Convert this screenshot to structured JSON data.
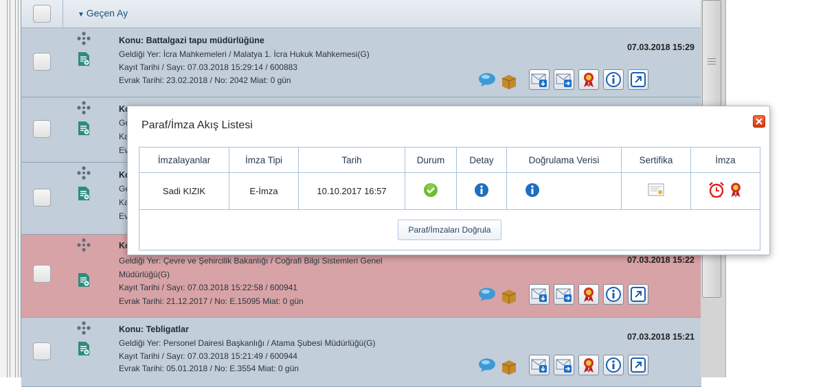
{
  "group": {
    "label": "Geçen Ay"
  },
  "rows": [
    {
      "subject": "Konu: Battalgazi tapu müdürlüğüne",
      "from": "Geldiği Yer: İcra Mahkemeleri / Malatya 1. İcra Hukuk Mahkemesi(G)",
      "record": "Kayıt Tarihi / Sayı: 07.03.2018 15:29:14 / 600883",
      "doc": "Evrak Tarihi: 23.02.2018 / No: 2042 Miat: 0 gün",
      "date": "07.03.2018 15:29",
      "highlight": false
    },
    {
      "subject": "Ko",
      "from": "Ge",
      "record": "Ka",
      "doc": "Ev",
      "date": "",
      "highlight": false
    },
    {
      "subject": "Ko",
      "from": "Ge",
      "record": "Ka",
      "doc": "Ev",
      "date": "",
      "highlight": false
    },
    {
      "subject": "Ko",
      "from": "Geldiği Yer: Çevre ve Şehircilik Bakanlığı / Coğrafi Bilgi Sistemleri Genel",
      "from2": "Müdürlüğü(G)",
      "record": "Kayıt Tarihi / Sayı: 07.03.2018 15:22:58 / 600941",
      "doc": "Evrak Tarihi: 21.12.2017 / No: E.15095 Miat: 0 gün",
      "date": "07.03.2018 15:22",
      "highlight": true
    },
    {
      "subject": "Konu: Tebligatlar",
      "from": "Geldiği Yer: Personel Dairesi Başkanlığı / Atama Şubesi Müdürlüğü(G)",
      "record": "Kayıt Tarihi / Sayı: 07.03.2018 15:21:49 / 600944",
      "doc": "Evrak Tarihi: 05.01.2018 / No: E.3554 Miat: 0 gün",
      "date": "07.03.2018 15:21",
      "highlight": false
    }
  ],
  "dialog": {
    "title": "Paraf/İmza Akış Listesi",
    "columns": [
      "İmzalayanlar",
      "İmza Tipi",
      "Tarih",
      "Durum",
      "Detay",
      "Doğrulama Verisi",
      "Sertifika",
      "İmza"
    ],
    "row": {
      "signer": "Sadi KIZIK",
      "type": "E-İmza",
      "date": "10.10.2017 16:57"
    },
    "verify_button": "Paraf/İmzaları Doğrula"
  },
  "icons": {
    "row": [
      "move-icon",
      "document-add-icon",
      "comment-bubble-icon",
      "package-icon",
      "download-mail-icon",
      "forward-mail-icon",
      "ribbon-award-icon",
      "info-icon",
      "open-external-icon"
    ],
    "dialog": [
      "close-icon",
      "check-status-icon",
      "info-icon",
      "certificate-icon",
      "alarm-clock-icon",
      "ribbon-award-icon"
    ]
  },
  "colors": {
    "row_bg": "#c2ced9",
    "highlight_bg": "#d8a3a6",
    "header_text": "#1e4f7f",
    "status_ok": "#6cbf2f",
    "info_blue": "#1f6fbf",
    "close_red": "#e0531f"
  }
}
